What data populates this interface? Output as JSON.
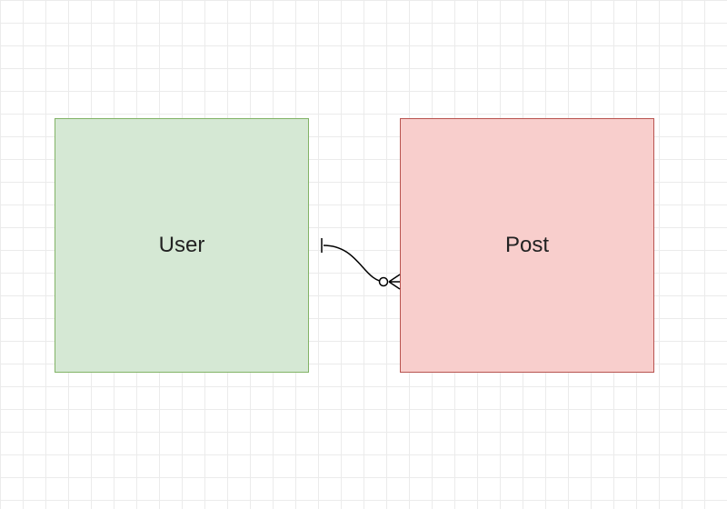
{
  "entities": {
    "user": {
      "label": "User"
    },
    "post": {
      "label": "Post"
    }
  },
  "relationship": {
    "from": "User",
    "to": "Post",
    "from_cardinality": "one",
    "to_cardinality": "zero-or-many"
  }
}
